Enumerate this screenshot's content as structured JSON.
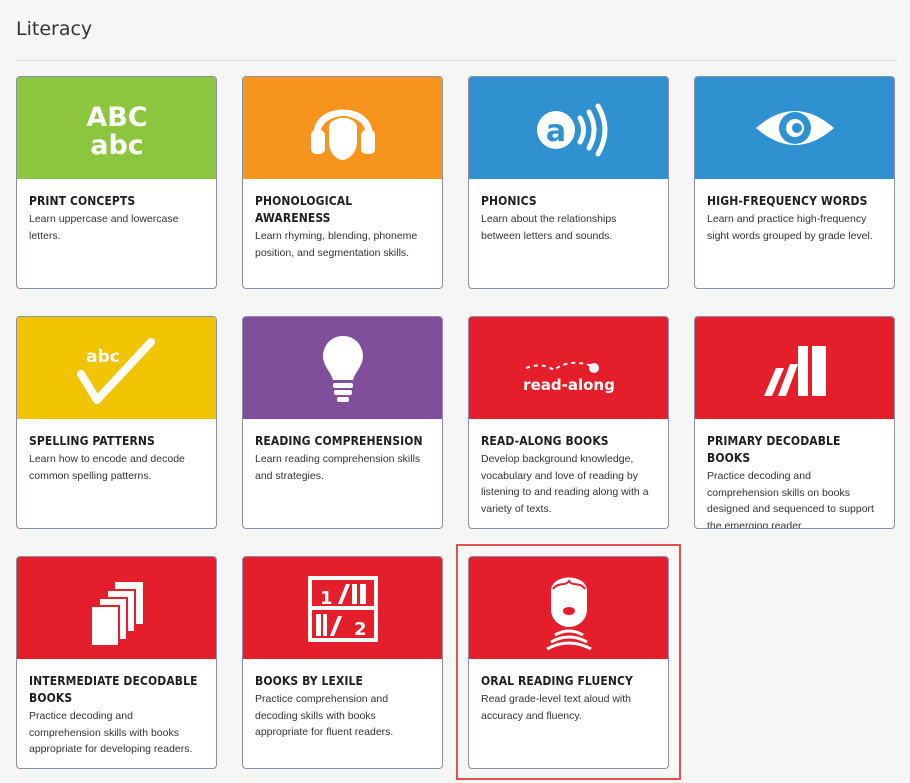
{
  "section": {
    "title": "Literacy"
  },
  "colors": {
    "green": "#8cc63f",
    "orange": "#f7941d",
    "blue": "#3091d1",
    "yellow": "#f0c400",
    "purple": "#7f4f9c",
    "red": "#e41e2b"
  },
  "cards": [
    {
      "title": "PRINT CONCEPTS",
      "description": "Learn uppercase and lowercase letters.",
      "icon": "abc-letters-icon",
      "icon_text_upper": "ABC",
      "icon_text_lower": "abc"
    },
    {
      "title": "PHONOLOGICAL AWARENESS",
      "description": "Learn rhyming, blending, phoneme position, and segmentation skills.",
      "icon": "headphones-head-icon"
    },
    {
      "title": "PHONICS",
      "description": "Learn about the relationships between letters and sounds.",
      "icon": "letter-sound-icon",
      "icon_text": "a"
    },
    {
      "title": "HIGH-FREQUENCY WORDS",
      "description": "Learn and practice high-frequency sight words grouped by grade level.",
      "icon": "eye-icon"
    },
    {
      "title": "SPELLING PATTERNS",
      "description": "Learn how to encode and decode common spelling patterns.",
      "icon": "abc-checkmark-icon",
      "icon_text": "abc"
    },
    {
      "title": "READING COMPREHENSION",
      "description": "Learn reading comprehension skills and strategies.",
      "icon": "lightbulb-icon"
    },
    {
      "title": "READ-ALONG BOOKS",
      "description": "Develop background knowledge, vocabulary and love of reading by listening to and reading along with a variety of texts.",
      "icon": "read-along-icon",
      "icon_text": "read-along"
    },
    {
      "title": "PRIMARY DECODABLE BOOKS",
      "description": "Practice decoding and comprehension skills on books designed and sequenced to support the emerging reader.",
      "icon": "books-leaning-icon"
    },
    {
      "title": "INTERMEDIATE DECODABLE BOOKS",
      "description": "Practice decoding and comprehension skills with books appropriate for developing readers.",
      "icon": "book-stack-icon"
    },
    {
      "title": "BOOKS BY LEXILE",
      "description": "Practice comprehension and decoding skills with books appropriate for fluent readers.",
      "icon": "bookshelf-icon",
      "icon_text_1": "1",
      "icon_text_2": "2"
    },
    {
      "title": "ORAL READING FLUENCY",
      "description": "Read grade-level text aloud with accuracy and fluency.",
      "icon": "speaking-head-icon",
      "selected": true
    }
  ]
}
